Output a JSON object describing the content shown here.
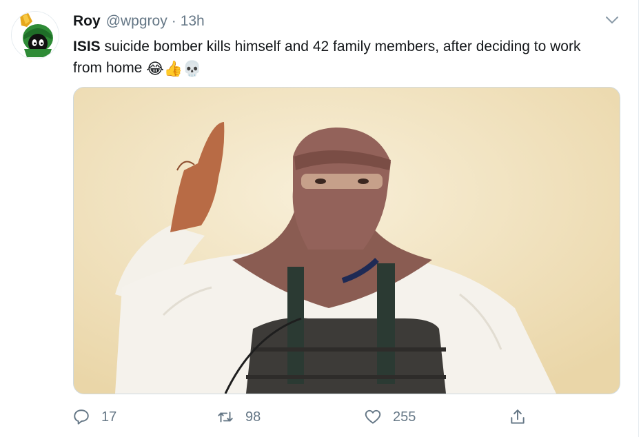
{
  "tweet": {
    "author_name": "Roy",
    "author_handle": "@wpgroy",
    "separator": "·",
    "timestamp": "13h",
    "text_bold": "ISIS",
    "text_rest": " suicide bomber kills himself and 42 family members, after deciding to work from home ",
    "emojis": [
      "😂",
      "👍",
      "💀"
    ],
    "media_icon": "photo"
  },
  "actions": {
    "reply_count": "17",
    "retweet_count": "98",
    "like_count": "255",
    "reply_icon": "reply-icon",
    "retweet_icon": "retweet-icon",
    "like_icon": "heart-icon",
    "share_icon": "share-icon"
  },
  "colors": {
    "text_primary": "#14171a",
    "text_secondary": "#657786",
    "border": "#e6ecf0",
    "media_background": "#f3e6c4"
  }
}
